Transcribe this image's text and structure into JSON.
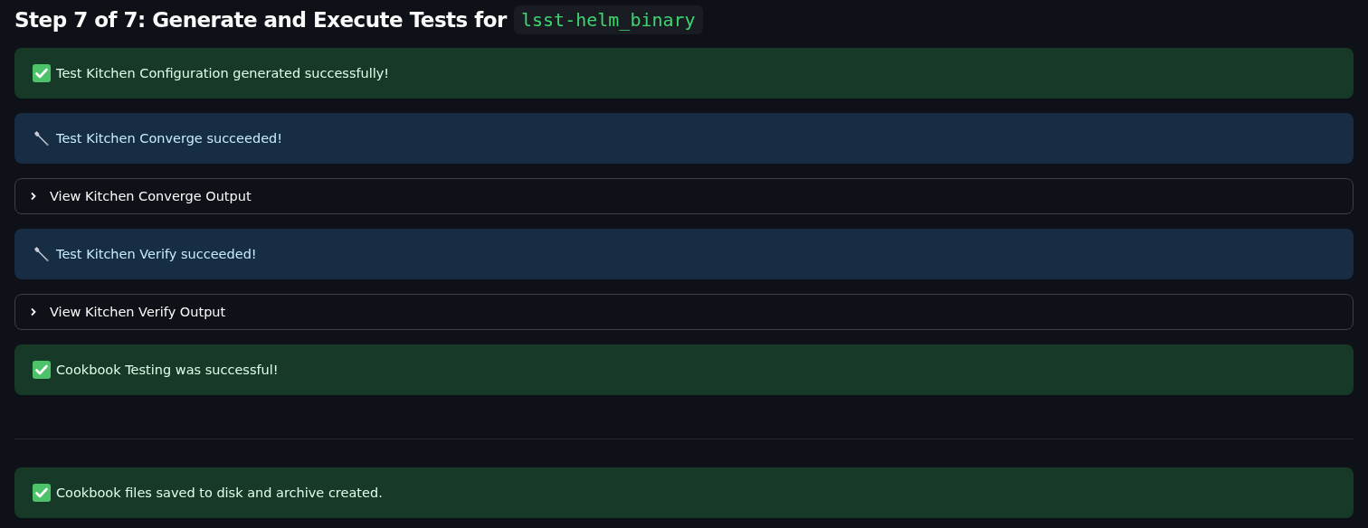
{
  "title": {
    "text": "Step 7 of 7: Generate and Execute Tests for",
    "code": "lsst-helm_binary"
  },
  "items": [
    {
      "kind": "success",
      "text": "Test Kitchen Configuration generated successfully!"
    },
    {
      "kind": "info",
      "text": "Test Kitchen Converge succeeded!"
    },
    {
      "kind": "expander",
      "text": "View Kitchen Converge Output",
      "expanded": false
    },
    {
      "kind": "info",
      "text": "Test Kitchen Verify succeeded!"
    },
    {
      "kind": "expander",
      "text": "View Kitchen Verify Output",
      "expanded": false
    },
    {
      "kind": "success",
      "text": "Cookbook Testing was successful!"
    },
    {
      "kind": "divider"
    },
    {
      "kind": "success",
      "text": "Cookbook files saved to disk and archive created."
    }
  ]
}
